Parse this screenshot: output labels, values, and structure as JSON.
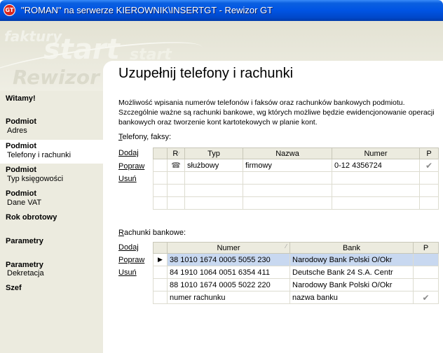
{
  "window": {
    "title": "\"ROMAN\" na serwerze KIEROWNIK\\INSERTGT - Rewizor GT",
    "icon_text": "GT"
  },
  "banner": {
    "wm1": "faktury",
    "wm2": "start",
    "wm3": "start",
    "wm4": "Rewizor"
  },
  "sidebar": {
    "items": [
      {
        "bold": "Witamy!",
        "sub": ""
      },
      {
        "bold": "Podmiot",
        "sub": "Adres"
      },
      {
        "bold": "Podmiot",
        "sub": "Telefony i rachunki"
      },
      {
        "bold": "Podmiot",
        "sub": "Typ księgowości"
      },
      {
        "bold": "Podmiot",
        "sub": "Dane VAT"
      },
      {
        "bold": "Rok obrotowy",
        "sub": ""
      },
      {
        "bold": "Parametry",
        "sub": ""
      },
      {
        "bold": "Parametry",
        "sub": "Dekretacja"
      },
      {
        "bold": "Szef",
        "sub": ""
      }
    ]
  },
  "main": {
    "title": "Uzupełnij telefony i rachunki",
    "description": "Możliwość wpisania numerów telefonów i faksów oraz rachunków bankowych podmiotu. Szczególnie ważne są rachunki bankowe, wg których możliwe będzie ewidencjonowanie operacji bankowych oraz tworzenie kont kartotekowych w planie kont.",
    "phones": {
      "label_first": "T",
      "label_rest": "elefony, faksy:",
      "actions": {
        "add": "Dodaj",
        "edit": "Popraw",
        "delete": "Usuń"
      },
      "columns": {
        "r": "R",
        "type": "Typ",
        "name": "Nazwa",
        "number": "Numer",
        "p": "P"
      },
      "rows": [
        {
          "type": "służbowy",
          "name": "firmowy",
          "number": "0-12 4356724"
        }
      ]
    },
    "accounts": {
      "label_first": "R",
      "label_rest": "achunki bankowe:",
      "actions": {
        "add": "Dodaj",
        "edit": "Popraw",
        "delete": "Usuń"
      },
      "columns": {
        "number": "Numer",
        "bank": "Bank",
        "p": "P"
      },
      "rows": [
        {
          "number": "38 1010 1674 0005 5055 230",
          "bank": "Narodowy Bank Polski O/Okr"
        },
        {
          "number": "84 1910 1064 0051 6354 411",
          "bank": "Deutsche Bank 24 S.A. Centr"
        },
        {
          "number": "88 1010 1674 0005 5022 220",
          "bank": "Narodowy Bank Polski O/Okr"
        }
      ],
      "new_row": {
        "number": "numer rachunku",
        "bank": "nazwa banku"
      }
    }
  }
}
